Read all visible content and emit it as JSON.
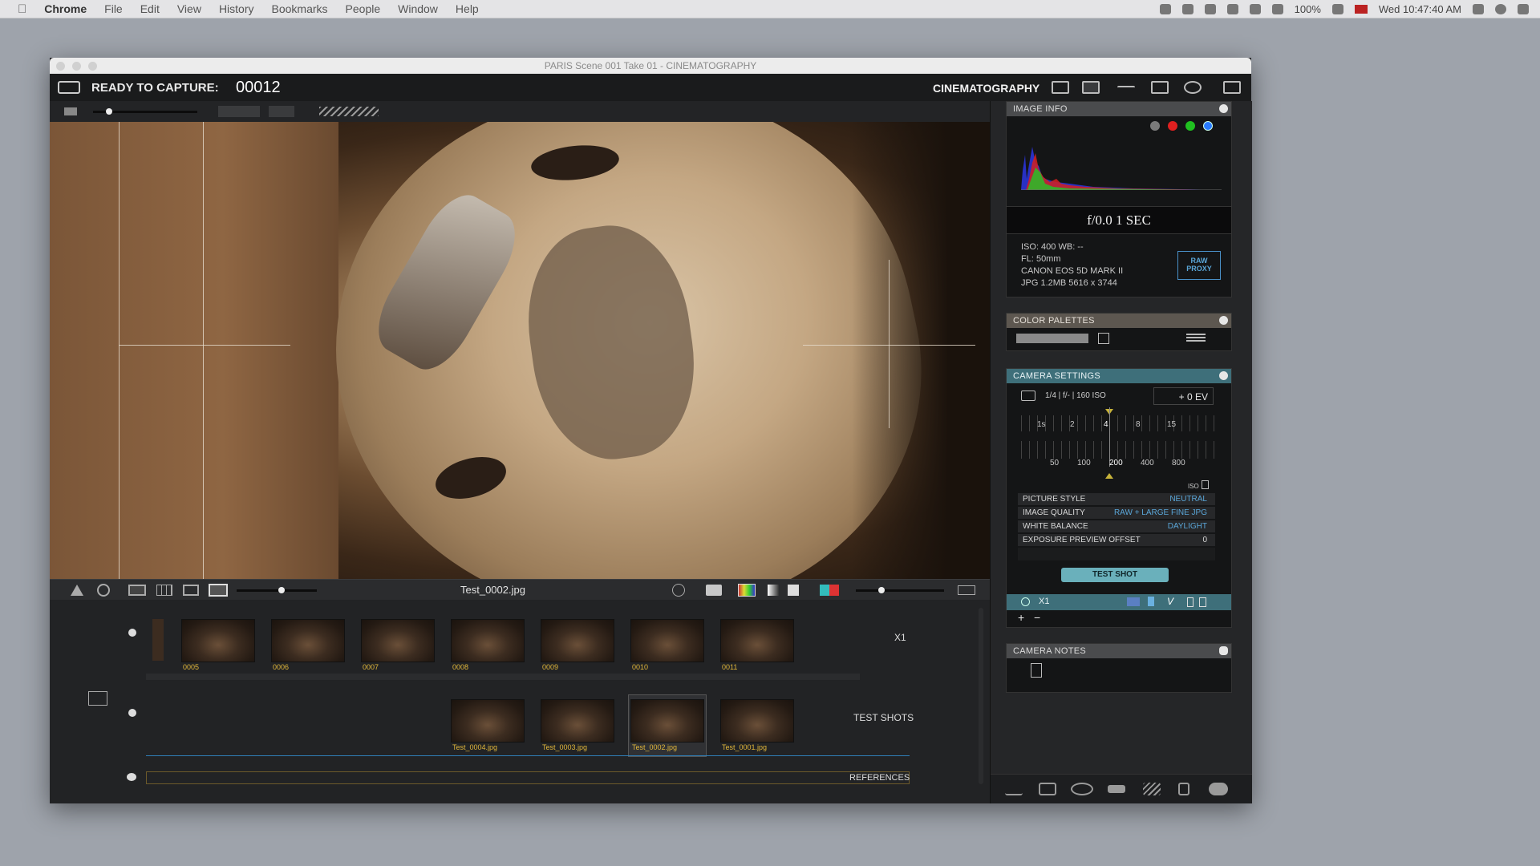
{
  "menubar": {
    "app": "Chrome",
    "items": [
      "File",
      "Edit",
      "View",
      "History",
      "Bookmarks",
      "People",
      "Window",
      "Help"
    ],
    "battery": "100%",
    "clock": "Wed 10:47:40 AM"
  },
  "window": {
    "title": "PARIS  Scene 001  Take 01 - CINEMATOGRAPHY"
  },
  "toolbar": {
    "status": "READY TO CAPTURE:",
    "counter": "00012",
    "mode": "CINEMATOGRAPHY"
  },
  "viewport": {
    "filename": "Test_0002.jpg"
  },
  "strip": {
    "row1_label": "X1",
    "row1_thumbs": [
      "0005",
      "0006",
      "0007",
      "0008",
      "0009",
      "0010",
      "0011"
    ],
    "row2_label": "TEST SHOTS",
    "row2_thumbs": [
      "Test_0004.jpg",
      "Test_0003.jpg",
      "Test_0002.jpg",
      "Test_0001.jpg"
    ],
    "row3_label": "REFERENCES"
  },
  "image_info": {
    "header": "IMAGE INFO",
    "exposure": "f/0.0    1 SEC",
    "line1": "ISO: 400   WB: --",
    "line2": "FL: 50mm",
    "line3": "CANON EOS 5D MARK II",
    "line4": "JPG  1.2MB  5616 x 3744",
    "raw_proxy_1": "RAW",
    "raw_proxy_2": "PROXY"
  },
  "color_palettes": {
    "header": "COLOR PALETTES"
  },
  "camera_settings": {
    "header": "CAMERA SETTINGS",
    "summary": "1/4 | f/- | 160 ISO",
    "ev": "+ 0 EV",
    "shutter_ticks": [
      "1s",
      "2",
      "4",
      "8",
      "15"
    ],
    "iso_ticks": [
      "50",
      "100",
      "200",
      "400",
      "800"
    ],
    "iso_label": "ISO",
    "rows": [
      {
        "label": "PICTURE STYLE",
        "value": "NEUTRAL"
      },
      {
        "label": "IMAGE QUALITY",
        "value": "RAW + LARGE FINE JPG"
      },
      {
        "label": "WHITE BALANCE",
        "value": "DAYLIGHT"
      },
      {
        "label": "EXPOSURE PREVIEW OFFSET",
        "value": "0"
      }
    ],
    "test_shot": "TEST SHOT",
    "x1": "X1",
    "add": "+",
    "remove": "−"
  },
  "camera_notes": {
    "header": "CAMERA NOTES"
  }
}
